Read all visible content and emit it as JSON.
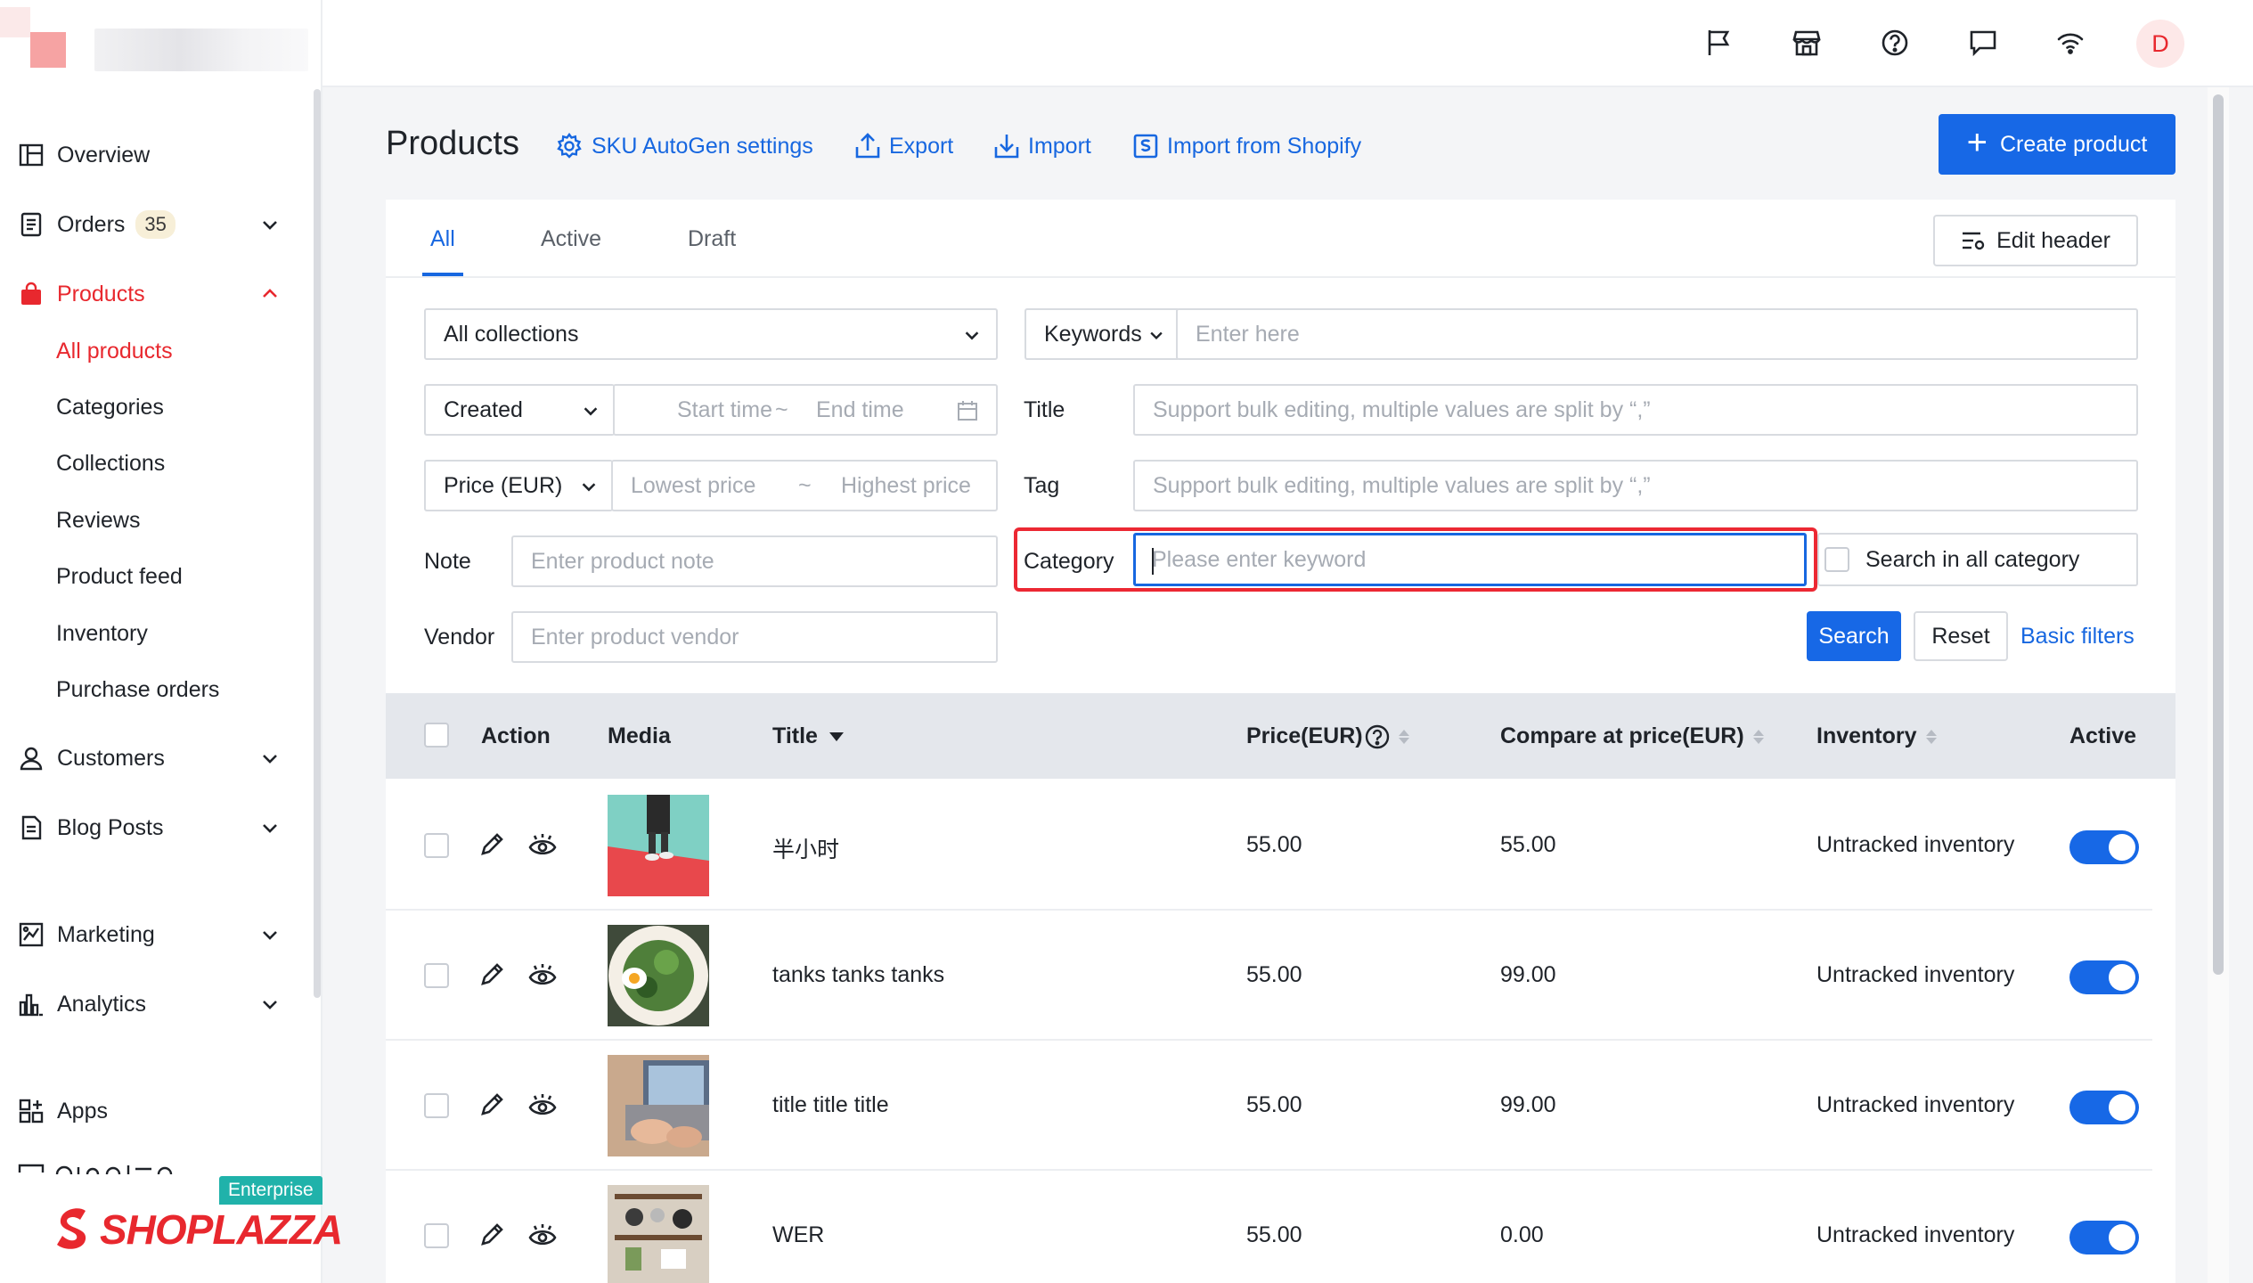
{
  "sidebar": {
    "items": [
      {
        "label": "Overview"
      },
      {
        "label": "Orders",
        "badge": "35"
      },
      {
        "label": "Products"
      },
      {
        "label": "Customers"
      },
      {
        "label": "Blog Posts"
      },
      {
        "label": "Marketing"
      },
      {
        "label": "Analytics"
      },
      {
        "label": "Apps"
      }
    ],
    "products_sub": [
      "All products",
      "Categories",
      "Collections",
      "Reviews",
      "Product feed",
      "Inventory",
      "Purchase orders"
    ],
    "enterprise_label": "Enterprise",
    "brand": "SHOPLAZZA"
  },
  "topbar": {
    "icons": [
      "flag-icon",
      "store-icon",
      "help-icon",
      "chat-icon",
      "wifi-icon"
    ],
    "avatar_initial": "D"
  },
  "header": {
    "title": "Products",
    "links": [
      "SKU AutoGen settings",
      "Export",
      "Import",
      "Import from Shopify"
    ],
    "create_label": "Create product"
  },
  "tabs": [
    "All",
    "Active",
    "Draft"
  ],
  "edit_header_label": "Edit header",
  "filters": {
    "collections_value": "All collections",
    "keywords_label": "Keywords",
    "keywords_placeholder": "Enter here",
    "date_type": "Created",
    "start_placeholder": "Start time",
    "end_placeholder": "End time",
    "range_sep": "~",
    "title_label": "Title",
    "title_placeholder": "Support bulk editing, multiple values are split by “,”",
    "price_type": "Price (EUR)",
    "lowest_placeholder": "Lowest price",
    "highest_placeholder": "Highest price",
    "tag_label": "Tag",
    "tag_placeholder": "Support bulk editing, multiple values are split by “,”",
    "note_label": "Note",
    "note_placeholder": "Enter product note",
    "category_label": "Category",
    "category_placeholder": "Please enter keyword",
    "search_all_label": "Search in all category",
    "vendor_label": "Vendor",
    "vendor_placeholder": "Enter product vendor",
    "search_label": "Search",
    "reset_label": "Reset",
    "basic_filters_label": "Basic filters"
  },
  "table": {
    "headers": {
      "action": "Action",
      "media": "Media",
      "title": "Title",
      "price": "Price(EUR)",
      "compare": "Compare at price(EUR)",
      "inventory": "Inventory",
      "active": "Active"
    },
    "rows": [
      {
        "title": "半小时",
        "price": "55.00",
        "compare": "55.00",
        "inventory": "Untracked inventory",
        "active": true
      },
      {
        "title": "tanks tanks tanks",
        "price": "55.00",
        "compare": "99.00",
        "inventory": "Untracked inventory",
        "active": true
      },
      {
        "title": "title title title",
        "price": "55.00",
        "compare": "99.00",
        "inventory": "Untracked inventory",
        "active": true
      },
      {
        "title": "WER",
        "price": "55.00",
        "compare": "0.00",
        "inventory": "Untracked inventory",
        "active": true
      }
    ]
  },
  "colors": {
    "accent": "#1768e6",
    "brand_red": "#e8282e",
    "highlight": "#ec2833"
  }
}
